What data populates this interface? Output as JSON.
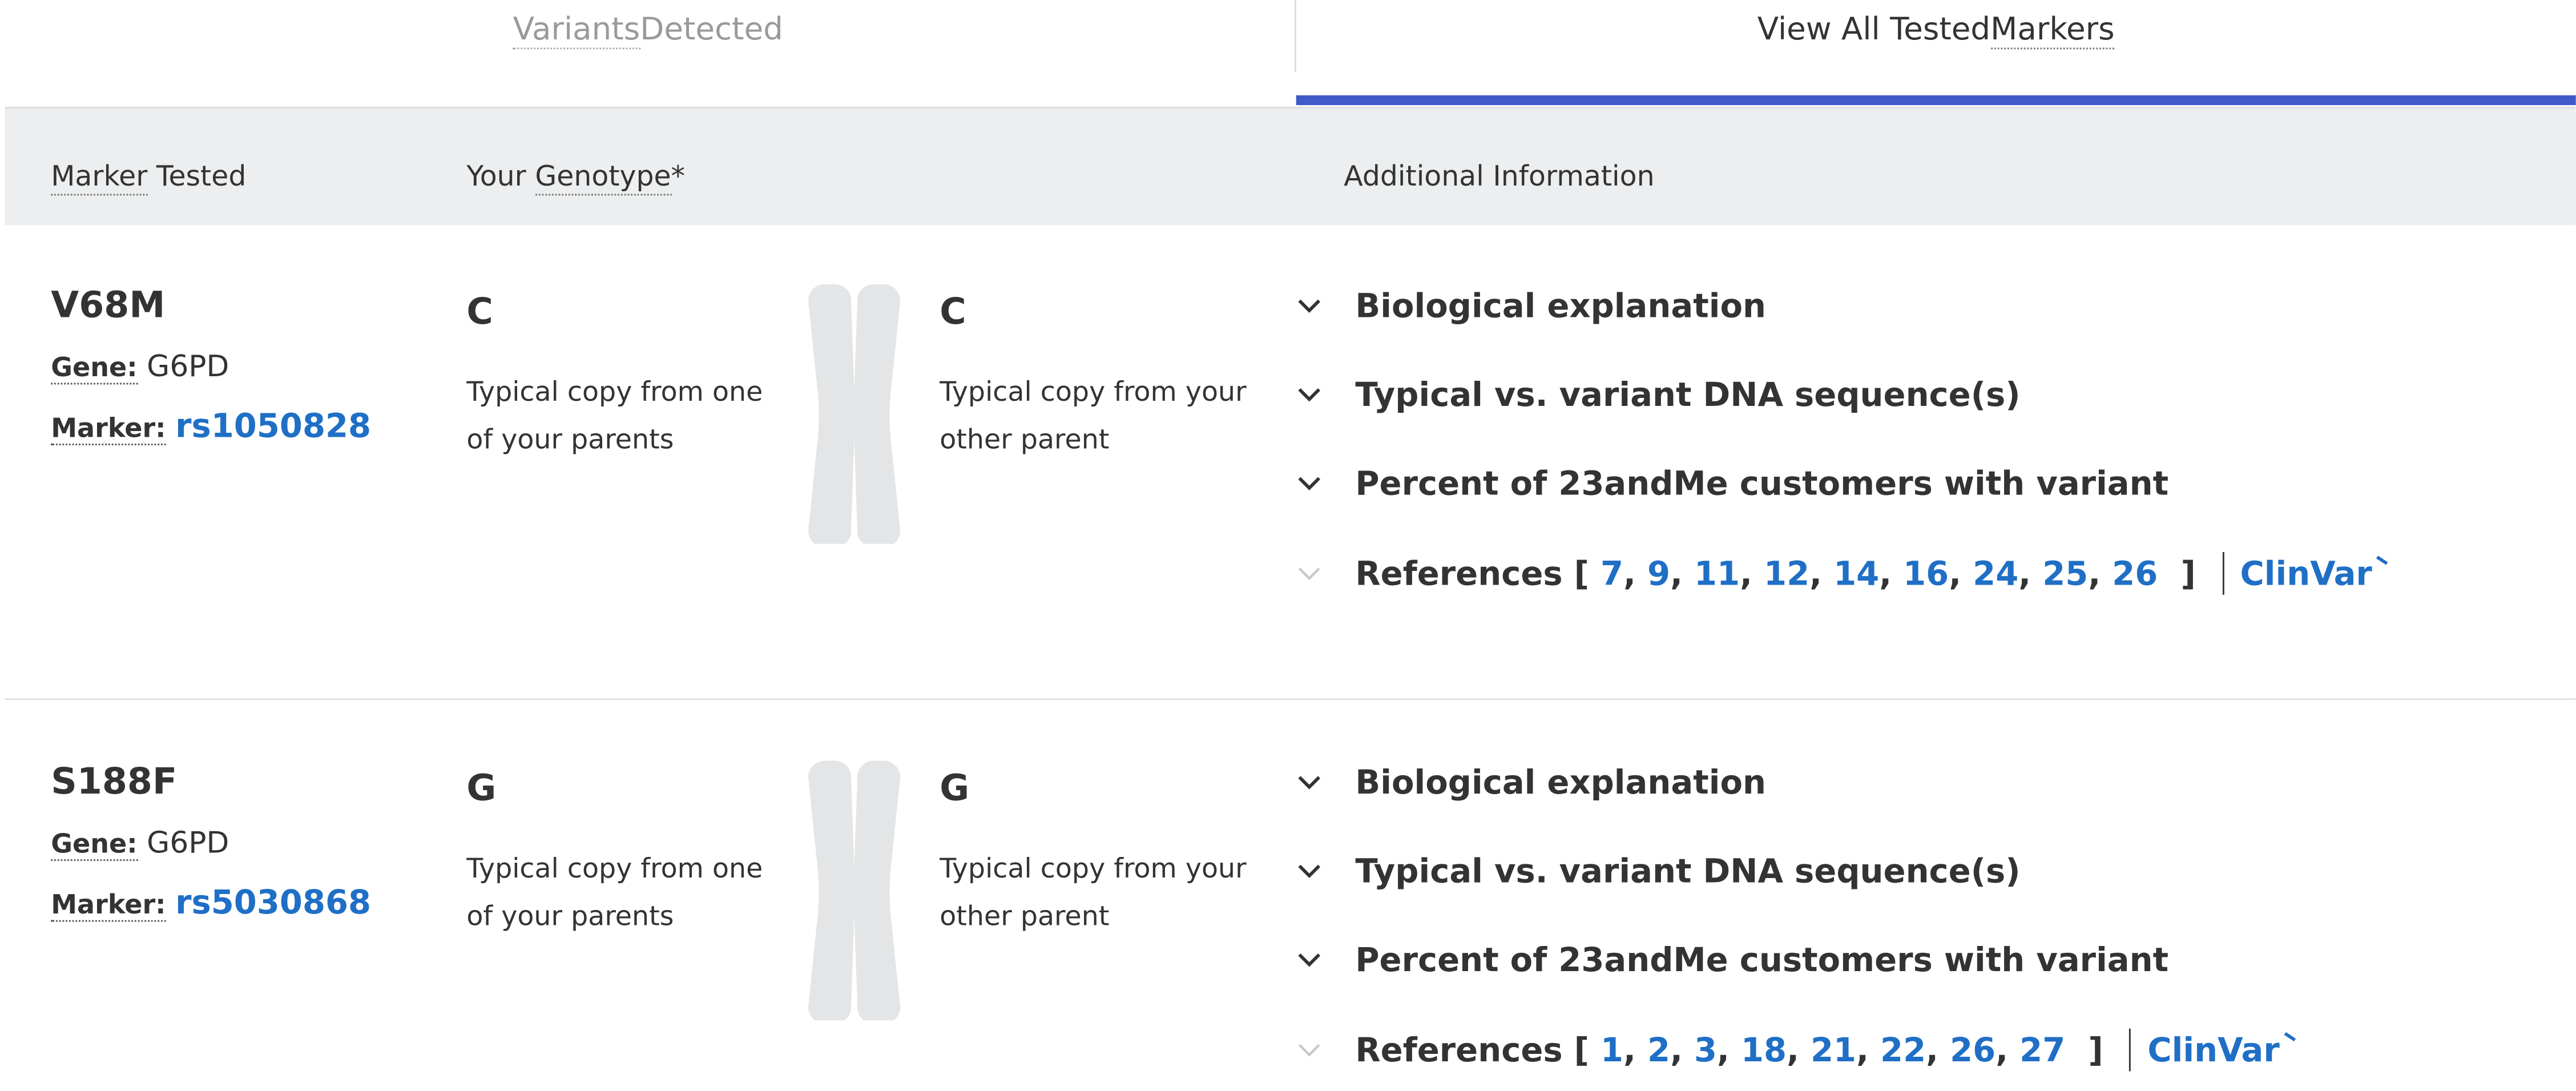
{
  "tabs": {
    "variants_detected_prefix": "Variants",
    "variants_detected_suffix": " Detected",
    "view_all_prefix": "View All Tested ",
    "view_all_suffix": "Markers"
  },
  "header": {
    "marker_tested_a": "Marker",
    "marker_tested_b": " Tested",
    "your_genotype_a": "Your ",
    "your_genotype_b": "Genotype",
    "your_genotype_c": "*",
    "additional_info": "Additional Information"
  },
  "rows": [
    {
      "name": "V68M",
      "gene_label": "Gene:",
      "gene": "G6PD",
      "marker_label": "Marker:",
      "rsid": "rs1050828",
      "allele1": "C",
      "allele1_desc": "Typical copy from one of your parents",
      "allele2": "C",
      "allele2_desc": "Typical copy from your other parent",
      "info": [
        "Biological explanation",
        "Typical vs. variant DNA sequence(s)",
        "Percent of 23andMe customers with variant"
      ],
      "refs_label": "References [",
      "refs": [
        "7",
        "9",
        "11",
        "12",
        "14",
        "16",
        "24",
        "25",
        "26"
      ],
      "refs_close": "]",
      "clinvar": "ClinVar"
    },
    {
      "name": "S188F",
      "gene_label": "Gene:",
      "gene": "G6PD",
      "marker_label": "Marker:",
      "rsid": "rs5030868",
      "allele1": "G",
      "allele1_desc": "Typical copy from one of your parents",
      "allele2": "G",
      "allele2_desc": "Typical copy from your other parent",
      "info": [
        "Biological explanation",
        "Typical vs. variant DNA sequence(s)",
        "Percent of 23andMe customers with variant"
      ],
      "refs_label": "References [",
      "refs": [
        "1",
        "2",
        "3",
        "18",
        "21",
        "22",
        "26",
        "27"
      ],
      "refs_close": "]",
      "clinvar": "ClinVar"
    }
  ],
  "icons": {
    "chevron": "chevron-down-icon",
    "chromosome": "chromosome-icon",
    "external": "external-link-icon"
  },
  "colors": {
    "accent": "#3f5bc7",
    "link": "#1f6fc6",
    "header_bg": "#eceeef",
    "chromosome": "#e3e5e6"
  }
}
